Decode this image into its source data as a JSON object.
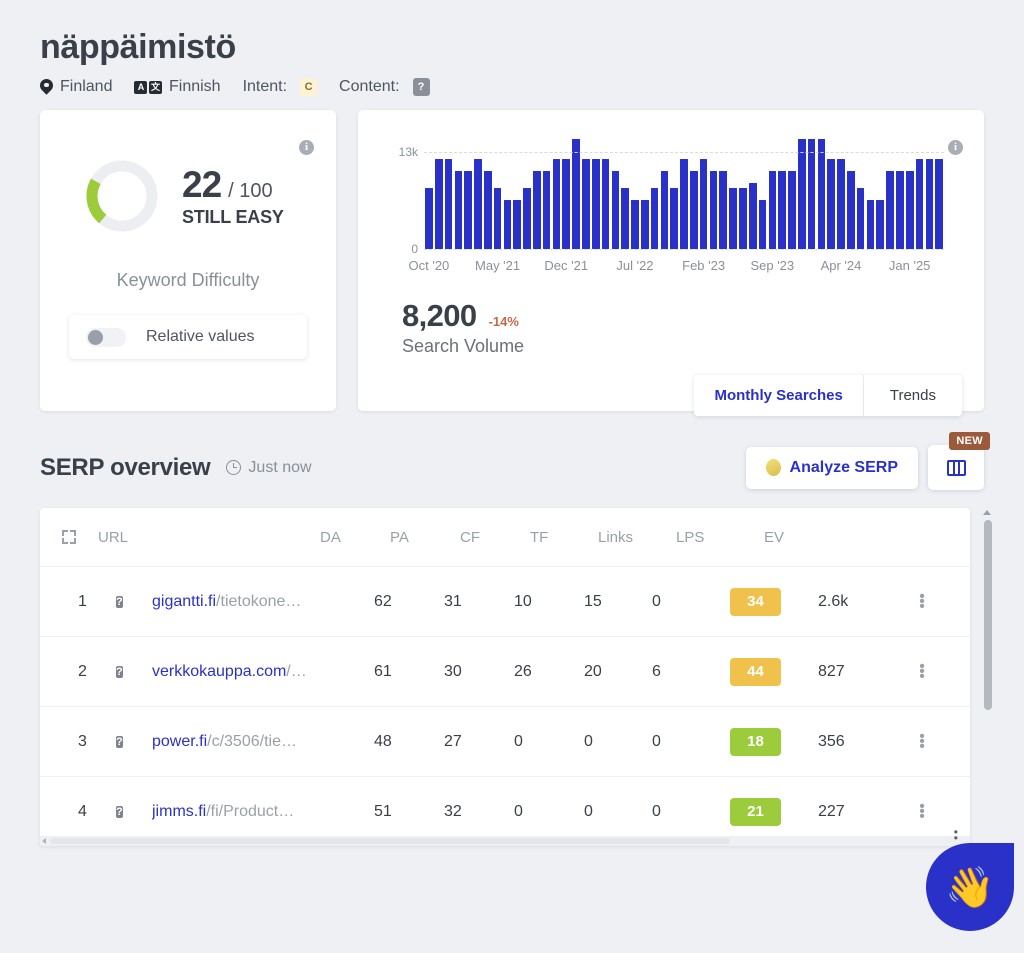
{
  "header": {
    "keyword": "näppäimistö",
    "country": "Finland",
    "language": "Finnish",
    "intent_label": "Intent:",
    "intent_value": "C",
    "content_label": "Content:",
    "content_value": "?",
    "lang_icon_left": "A",
    "lang_icon_right": "文"
  },
  "keyword_difficulty": {
    "info_icon": "i",
    "score": "22",
    "out_of": "/ 100",
    "verdict": "STILL EASY",
    "caption": "Keyword Difficulty",
    "toggle_label": "Relative values",
    "toggle_on": false,
    "arc_color": "#9ccb3b",
    "track_color": "#edeef1",
    "score_percent": 22
  },
  "search_volume": {
    "info_icon": "i",
    "value": "8,200",
    "delta": "-14%",
    "caption": "Search Volume",
    "tabs": [
      {
        "label": "Monthly Searches",
        "active": true
      },
      {
        "label": "Trends",
        "active": false
      }
    ]
  },
  "chart_data": {
    "type": "bar",
    "title": "",
    "xlabel": "",
    "ylabel": "",
    "ylim": [
      0,
      13000
    ],
    "ytick_labels": [
      "13k",
      "0"
    ],
    "grid": false,
    "bar_color": "#2a31c9",
    "tick_labels": [
      "Oct '20",
      "May '21",
      "Dec '21",
      "Jul '22",
      "Feb '23",
      "Sep '23",
      "Apr '24",
      "Jan '25"
    ],
    "tick_indices": [
      0,
      7,
      14,
      21,
      28,
      35,
      42,
      49
    ],
    "categories": [
      "Oct '20",
      "Nov '20",
      "Dec '20",
      "Jan '21",
      "Feb '21",
      "Mar '21",
      "Apr '21",
      "May '21",
      "Jun '21",
      "Jul '21",
      "Aug '21",
      "Sep '21",
      "Oct '21",
      "Nov '21",
      "Dec '21",
      "Jan '22",
      "Feb '22",
      "Mar '22",
      "Apr '22",
      "May '22",
      "Jun '22",
      "Jul '22",
      "Aug '22",
      "Sep '22",
      "Oct '22",
      "Nov '22",
      "Dec '22",
      "Jan '23",
      "Feb '23",
      "Mar '23",
      "Apr '23",
      "May '23",
      "Jun '23",
      "Jul '23",
      "Aug '23",
      "Sep '23",
      "Oct '23",
      "Nov '23",
      "Dec '23",
      "Jan '24",
      "Feb '24",
      "Mar '24",
      "Apr '24",
      "May '24",
      "Jun '24",
      "Jul '24",
      "Aug '24",
      "Sep '24",
      "Oct '24",
      "Nov '24",
      "Dec '24",
      "Jan '25",
      "Feb '25"
    ],
    "values": [
      8200,
      12100,
      12100,
      10500,
      10500,
      12100,
      10500,
      8200,
      6600,
      6600,
      8200,
      10500,
      10500,
      12100,
      12100,
      14800,
      12100,
      12100,
      12100,
      10500,
      8200,
      6600,
      6600,
      8200,
      10500,
      8200,
      12100,
      10500,
      12100,
      10500,
      10500,
      8200,
      8200,
      8900,
      6600,
      10500,
      10500,
      10500,
      14800,
      14800,
      14800,
      12100,
      12100,
      10500,
      8200,
      6600,
      6600,
      10500,
      10500,
      10500,
      12100,
      12100,
      12100
    ]
  },
  "serp": {
    "title": "SERP overview",
    "updated": "Just now",
    "analyze_button": "Analyze SERP",
    "new_badge": "NEW",
    "columns": [
      "URL",
      "DA",
      "PA",
      "CF",
      "TF",
      "Links",
      "LPS",
      "EV"
    ],
    "rows": [
      {
        "rank": "1",
        "favicon": "?",
        "domain": "gigantti.fi",
        "path": "/tietokone…",
        "da": "62",
        "pa": "31",
        "cf": "10",
        "tf": "15",
        "links": "0",
        "lps": "34",
        "lps_color": "#f0c14b",
        "ev": "2.6k"
      },
      {
        "rank": "2",
        "favicon": "?",
        "domain": "verkkokauppa.com",
        "path": "/…",
        "da": "61",
        "pa": "30",
        "cf": "26",
        "tf": "20",
        "links": "6",
        "lps": "44",
        "lps_color": "#f0c14b",
        "ev": "827"
      },
      {
        "rank": "3",
        "favicon": "?",
        "domain": "power.fi",
        "path": "/c/3506/tie…",
        "da": "48",
        "pa": "27",
        "cf": "0",
        "tf": "0",
        "links": "0",
        "lps": "18",
        "lps_color": "#9ccb3b",
        "ev": "356"
      },
      {
        "rank": "4",
        "favicon": "?",
        "domain": "jimms.fi",
        "path": "/fi/Product…",
        "da": "51",
        "pa": "32",
        "cf": "0",
        "tf": "0",
        "links": "0",
        "lps": "21",
        "lps_color": "#9ccb3b",
        "ev": "227"
      }
    ]
  },
  "chat": {
    "emoji": "👋"
  }
}
